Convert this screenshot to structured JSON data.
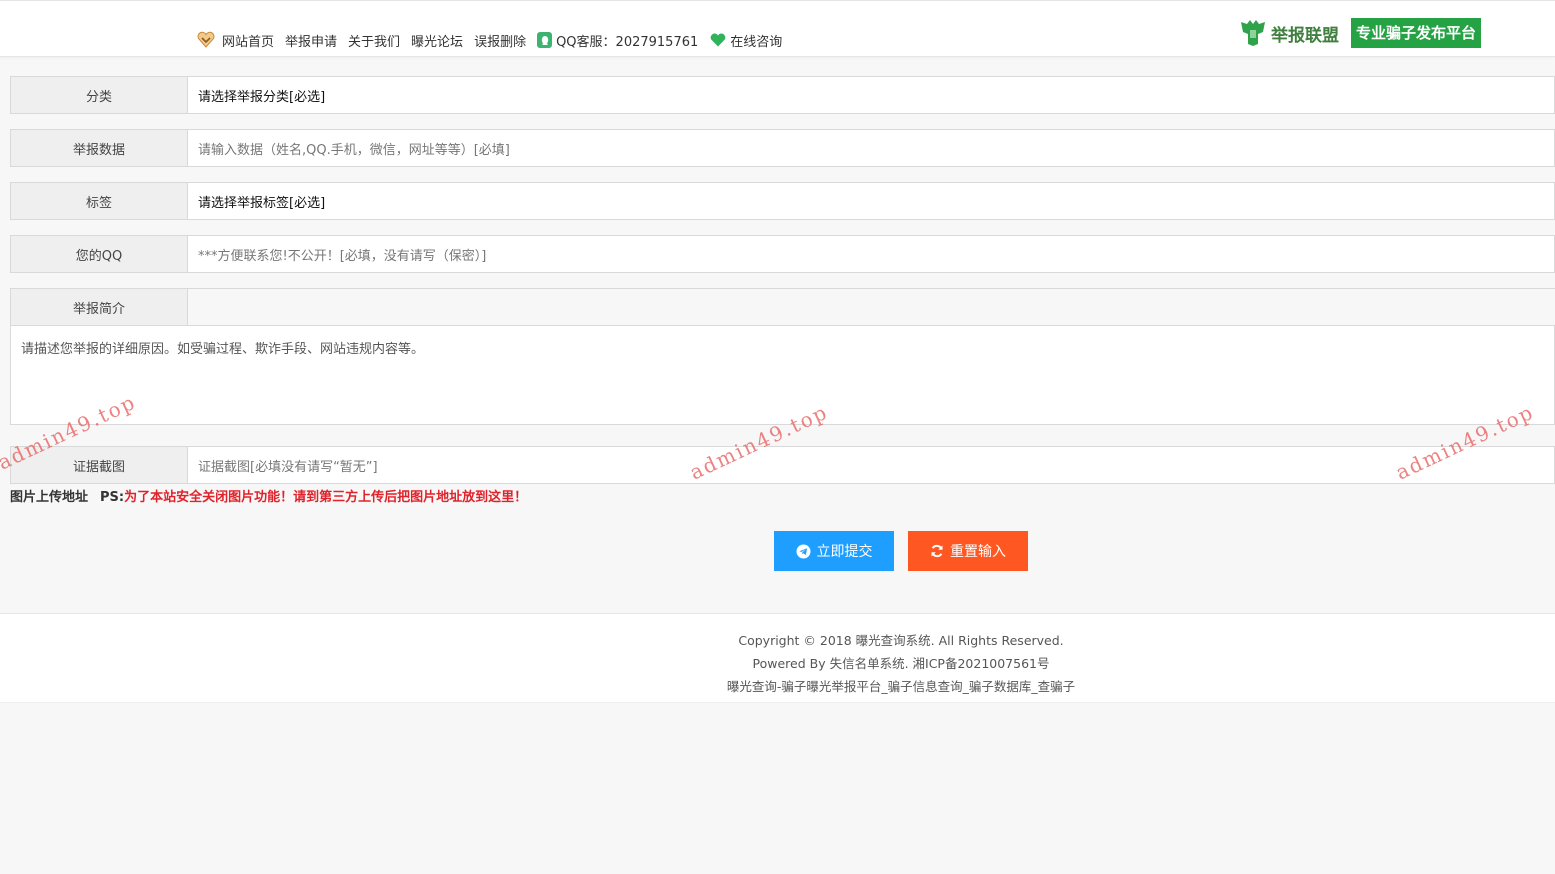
{
  "nav": {
    "items": [
      "网站首页",
      "举报申请",
      "关于我们",
      "曝光论坛",
      "误报删除"
    ],
    "qq_service": "QQ客服：2027915761",
    "online_consult": "在线咨询"
  },
  "brand": {
    "name": "举报联盟",
    "slogan": "专业骗子发布平台",
    "accent": "#25a244"
  },
  "form": {
    "category": {
      "label": "分类",
      "value": "请选择举报分类[必选]"
    },
    "report_data": {
      "label": "举报数据",
      "placeholder": "请输入数据（姓名,QQ.手机，微信，网址等等）[必填]"
    },
    "tag": {
      "label": "标签",
      "value": "请选择举报标签[必选]"
    },
    "your_qq": {
      "label": "您的QQ",
      "placeholder": "***方便联系您!不公开！[必填，没有请写（保密）]"
    },
    "summary": {
      "label": "举报简介",
      "placeholder": "请描述您举报的详细原因。如受骗过程、欺诈手段、网站违规内容等。"
    },
    "evidence": {
      "label": "证据截图",
      "placeholder": "证据截图[必填没有请写“暂无”]"
    }
  },
  "upload_note": {
    "label": "图片上传地址",
    "ps": "PS:",
    "warning": "为了本站安全关闭图片功能！请到第三方上传后把图片地址放到这里！"
  },
  "buttons": {
    "submit": "立即提交",
    "reset": "重置输入",
    "submit_color": "#1e9fff",
    "reset_color": "#ff5722"
  },
  "footer": {
    "copyright": "Copyright © 2018 曝光查询系统. All Rights Reserved.",
    "powered": "Powered By 失信名单系统. 湘ICP备2021007561号",
    "keywords": "曝光查询-骗子曝光举报平台_骗子信息查询_骗子数据库_查骗子"
  },
  "watermark": "admin49.top"
}
